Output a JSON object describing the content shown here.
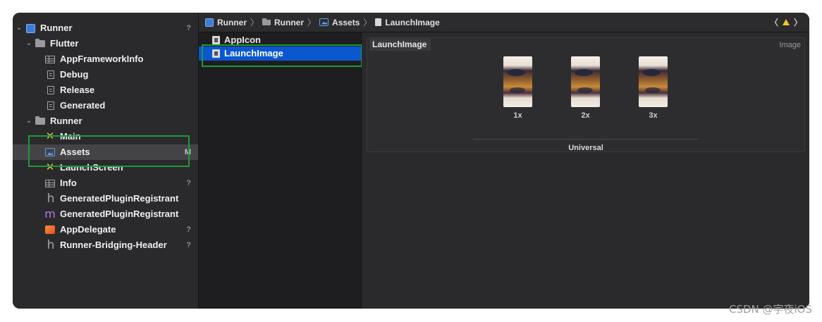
{
  "navigator": {
    "items": [
      {
        "label": "Runner",
        "badge": "?",
        "icon": "project-icon",
        "disclosure": "⌄"
      },
      {
        "label": "Flutter",
        "badge": "",
        "icon": "folder-icon",
        "disclosure": "⌄"
      },
      {
        "label": "AppFrameworkInfo",
        "badge": "",
        "icon": "plist-icon",
        "disclosure": ""
      },
      {
        "label": "Debug",
        "badge": "",
        "icon": "config-file-icon",
        "disclosure": ""
      },
      {
        "label": "Release",
        "badge": "",
        "icon": "config-file-icon",
        "disclosure": ""
      },
      {
        "label": "Generated",
        "badge": "",
        "icon": "config-file-icon",
        "disclosure": ""
      },
      {
        "label": "Runner",
        "badge": "",
        "icon": "folder-icon",
        "disclosure": "⌄"
      },
      {
        "label": "Main",
        "badge": "",
        "icon": "storyboard-icon",
        "disclosure": ""
      },
      {
        "label": "Assets",
        "badge": "M",
        "icon": "asset-catalog-icon",
        "disclosure": ""
      },
      {
        "label": "LaunchScreen",
        "badge": "",
        "icon": "storyboard-icon",
        "disclosure": ""
      },
      {
        "label": "Info",
        "badge": "?",
        "icon": "plist-icon",
        "disclosure": ""
      },
      {
        "label": "GeneratedPluginRegistrant",
        "badge": "",
        "icon": "header-file-icon",
        "disclosure": ""
      },
      {
        "label": "GeneratedPluginRegistrant",
        "badge": "",
        "icon": "objc-file-icon",
        "disclosure": ""
      },
      {
        "label": "AppDelegate",
        "badge": "?",
        "icon": "swift-file-icon",
        "disclosure": ""
      },
      {
        "label": "Runner-Bridging-Header",
        "badge": "?",
        "icon": "header-file-icon",
        "disclosure": ""
      }
    ],
    "glyphs": {
      "storyboard": "✕",
      "header": "h",
      "objc": "m"
    }
  },
  "jumpbar": {
    "crumbs": [
      {
        "label": "Runner",
        "icon": "project-icon"
      },
      {
        "label": "Runner",
        "icon": "folder-icon"
      },
      {
        "label": "Assets",
        "icon": "asset-catalog-icon"
      },
      {
        "label": "LaunchImage",
        "icon": "image-set-icon"
      }
    ],
    "separator": "〉",
    "nav_back": "〈",
    "nav_forward": "〉"
  },
  "asset_list": {
    "items": [
      {
        "label": "AppIcon",
        "selected": false
      },
      {
        "label": "LaunchImage",
        "selected": true
      }
    ]
  },
  "editor": {
    "set_name": "LaunchImage",
    "set_type": "Image",
    "slots": [
      "1x",
      "2x",
      "3x"
    ],
    "device_group": "Universal"
  },
  "watermark": "CSDN @宇夜iOS",
  "colors": {
    "highlight": "#1d9a3a",
    "selection": "#0a57d0",
    "warning": "#f4c430"
  }
}
